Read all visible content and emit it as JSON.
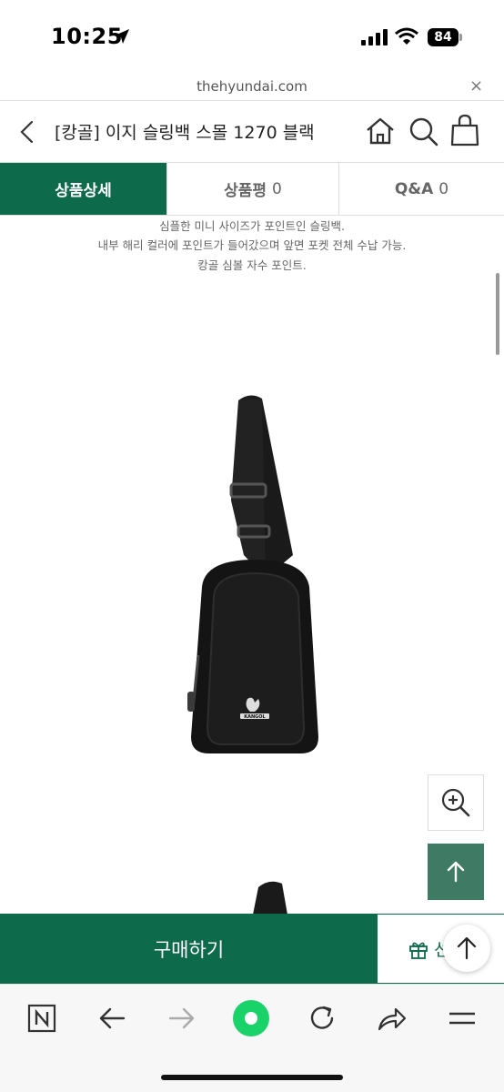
{
  "status": {
    "time": "10:25",
    "battery": "84"
  },
  "browser": {
    "url": "thehyundai.com",
    "close_glyph": "×"
  },
  "product": {
    "title": "[캉골] 이지 슬링백 스몰 1270 블랙"
  },
  "tabs": [
    {
      "label": "상품상세",
      "count": ""
    },
    {
      "label": "상품평",
      "count": "0"
    },
    {
      "label": "Q&A",
      "count": "0"
    }
  ],
  "description": [
    "심플한 미니 사이즈가 포인트인 슬링백.",
    "내부 해리 컬러에 포인트가 들어갔으며 앞면 포켓 전체 수납 가능.",
    "캉골 심볼 자수 포인트."
  ],
  "bag_logo": "KANGOL",
  "bottom": {
    "buy_label": "구매하기",
    "gift_label": "선"
  },
  "colors": {
    "brand": "#0d6a4a",
    "top_button": "#3f7b64",
    "nav_green": "#19d36a"
  },
  "icons": [
    "location-arrow-icon",
    "signal-icon",
    "wifi-icon",
    "battery-icon",
    "close-icon",
    "back-chevron-icon",
    "home-icon",
    "search-icon",
    "shopping-bag-icon",
    "zoom-in-icon",
    "arrow-up-icon",
    "gift-icon",
    "naver-n-icon",
    "back-arrow-icon",
    "forward-arrow-icon",
    "green-dot-icon",
    "reload-icon",
    "share-icon",
    "menu-icon"
  ]
}
